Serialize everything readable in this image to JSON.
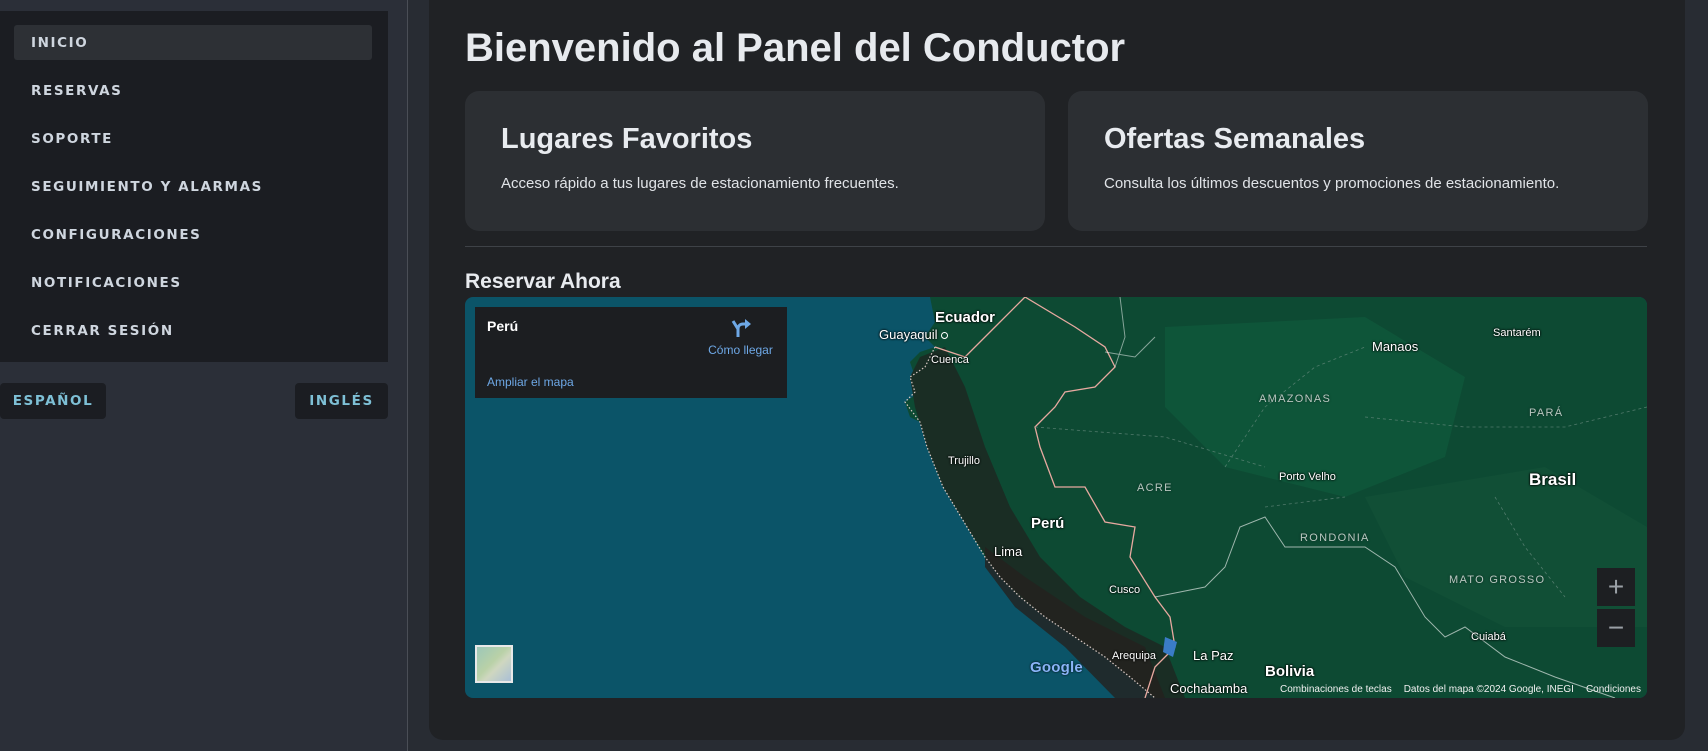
{
  "sidebar": {
    "items": [
      {
        "label": "INICIO"
      },
      {
        "label": "RESERVAS"
      },
      {
        "label": "SOPORTE"
      },
      {
        "label": "SEGUIMIENTO Y ALARMAS"
      },
      {
        "label": "CONFIGURACIONES"
      },
      {
        "label": "NOTIFICACIONES"
      },
      {
        "label": "CERRAR SESIÓN"
      }
    ],
    "languages": {
      "spanish": "ESPAÑOL",
      "english": "INGLÉS"
    }
  },
  "main": {
    "title": "Bienvenido al Panel del Conductor",
    "cards": [
      {
        "title": "Lugares Favoritos",
        "text": "Acceso rápido a tus lugares de estacionamiento frecuentes."
      },
      {
        "title": "Ofertas Semanales",
        "text": "Consulta los últimos descuentos y promociones de estacionamiento."
      }
    ],
    "section_title": "Reservar Ahora"
  },
  "map": {
    "info": {
      "place": "Perú",
      "directions": "Cómo llegar",
      "enlarge": "Ampliar el mapa"
    },
    "labels": {
      "ecuador": "Ecuador",
      "guayaquil": "Guayaquil",
      "cuenca": "Cuenca",
      "trujillo": "Trujillo",
      "peru": "Perú",
      "lima": "Lima",
      "cusco": "Cusco",
      "arequipa": "Arequipa",
      "la_paz": "La Paz",
      "bolivia": "Bolivia",
      "cochabamba": "Cochabamba",
      "manaos": "Manaos",
      "santarem": "Santarém",
      "amazonas": "AMAZONAS",
      "para": "PARÁ",
      "acre": "ACRE",
      "porto_velho": "Porto Velho",
      "brasil": "Brasil",
      "rondonia": "RONDONIA",
      "mato_grosso": "MATO GROSSO",
      "cuiaba": "Cuiabá"
    },
    "zoom_in": "+",
    "zoom_out": "−",
    "google": "Google",
    "attribution": {
      "shortcuts": "Combinaciones de teclas",
      "data": "Datos del mapa ©2024 Google, INEGI",
      "terms": "Condiciones"
    },
    "icons": {
      "directions": "directions-icon",
      "layers": "satellite-layer-icon"
    },
    "colors": {
      "ocean": "#0b5468",
      "land": "#0d4a33",
      "border": "#e7a9a0",
      "link": "#6ea8e6"
    }
  }
}
